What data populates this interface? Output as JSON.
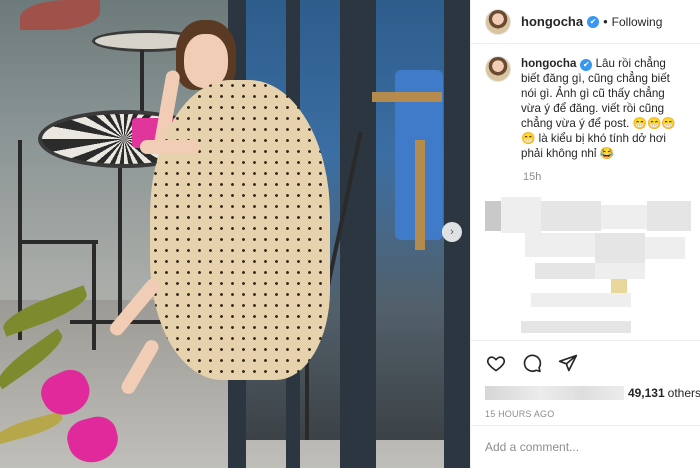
{
  "post": {
    "photo_alt": "",
    "next_arrow_glyph": "›"
  },
  "header": {
    "username": "hongocha",
    "verified_glyph": "✔",
    "separator": "•",
    "follow_status": "Following"
  },
  "caption": {
    "username": "hongocha",
    "verified_glyph": "✔",
    "text": " Lâu rồi chẳng biết đăng gì, cũng chẳng biết nói gì. Ảnh gì cũ thấy chẳng vừa ý để đăng. viết rồi cũng chẳng vừa ý để post. 😁😁😁 😁 là kiểu bị khó tính dở hơi phải không nhỉ 😂",
    "time": "15h"
  },
  "actions": {
    "like_icon": "heart-outline-icon",
    "comment_icon": "speech-bubble-icon",
    "share_icon": "paper-plane-icon"
  },
  "likes": {
    "count": "49,131",
    "suffix": "others"
  },
  "post_time": "15 HOURS AGO",
  "add_comment": {
    "placeholder": "Add a comment..."
  },
  "colors": {
    "verified_blue": "#3897f0",
    "text_primary": "#262626",
    "text_secondary": "#8e8e8e",
    "divider": "#efefef",
    "sandal_pink": "#e0299a"
  }
}
